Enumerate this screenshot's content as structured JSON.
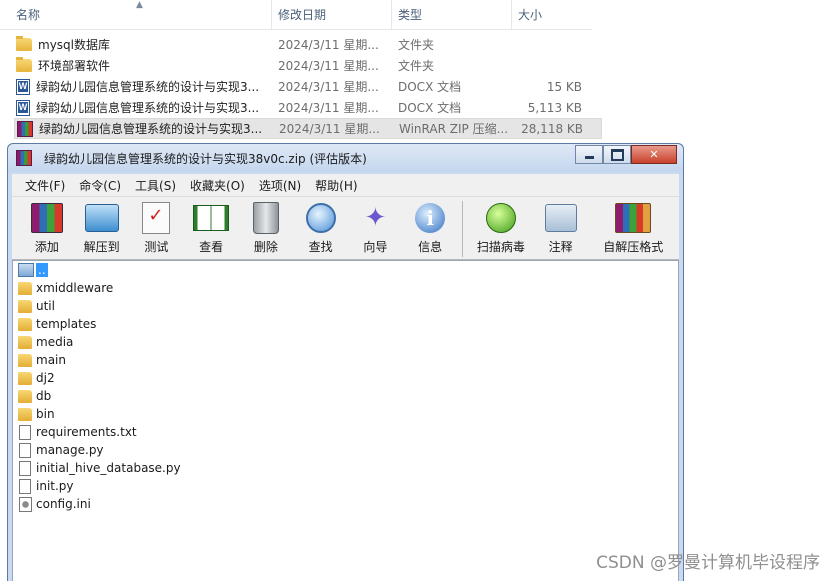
{
  "explorer": {
    "columns": {
      "name": "名称",
      "date": "修改日期",
      "type": "类型",
      "size": "大小"
    },
    "rows": [
      {
        "icon": "folder-icon",
        "name": "mysql数据库",
        "date": "2024/3/11 星期...",
        "type": "文件夹",
        "size": ""
      },
      {
        "icon": "folder-icon",
        "name": "环境部署软件",
        "date": "2024/3/11 星期...",
        "type": "文件夹",
        "size": ""
      },
      {
        "icon": "docx-icon",
        "name": "绿韵幼儿园信息管理系统的设计与实现3...",
        "date": "2024/3/11 星期...",
        "type": "DOCX 文档",
        "size": "15 KB"
      },
      {
        "icon": "docx-icon",
        "name": "绿韵幼儿园信息管理系统的设计与实现3...",
        "date": "2024/3/11 星期...",
        "type": "DOCX 文档",
        "size": "5,113 KB"
      },
      {
        "icon": "rar-icon",
        "name": "绿韵幼儿园信息管理系统的设计与实现3...",
        "date": "2024/3/11 星期...",
        "type": "WinRAR ZIP 压缩...",
        "size": "28,118 KB",
        "selected": true
      }
    ]
  },
  "winrar": {
    "title": "绿韵幼儿园信息管理系统的设计与实现38v0c.zip (评估版本)",
    "menu": [
      "文件(F)",
      "命令(C)",
      "工具(S)",
      "收藏夹(O)",
      "选项(N)",
      "帮助(H)"
    ],
    "toolbar": {
      "add": "添加",
      "extract": "解压到",
      "test": "测试",
      "view": "查看",
      "delete": "删除",
      "find": "查找",
      "wizard": "向导",
      "info": "信息",
      "scan": "扫描病毒",
      "comment": "注释",
      "sfx": "自解压格式"
    },
    "files": {
      "parent": "..",
      "folders": [
        "xmiddleware",
        "util",
        "templates",
        "media",
        "main",
        "dj2",
        "db",
        "bin"
      ],
      "docs": [
        "requirements.txt",
        "manage.py",
        "initial_hive_database.py",
        "init.py"
      ],
      "ini": "config.ini"
    }
  },
  "watermark": "CSDN @罗曼计算机毕设程序"
}
